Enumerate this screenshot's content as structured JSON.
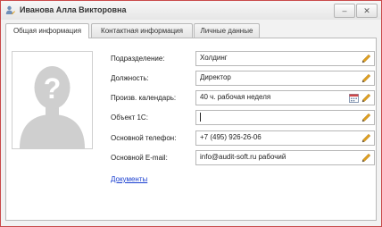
{
  "window": {
    "title": "Иванова Алла Викторовна",
    "minimize_symbol": "‒",
    "close_symbol": "✕",
    "icons": {
      "app": "user-edit-icon"
    }
  },
  "tabs": [
    {
      "label": "Общая информация",
      "active": true
    },
    {
      "label": "Контактная информация",
      "active": false
    },
    {
      "label": "Личные данные",
      "active": false
    }
  ],
  "photo": {
    "icon": "avatar-placeholder-icon"
  },
  "fields": {
    "department": {
      "label": "Подразделение:",
      "value": "Холдинг"
    },
    "position": {
      "label": "Должность:",
      "value": "Директор"
    },
    "calendar": {
      "label": "Произв. календарь:",
      "value": "40 ч. рабочая неделя"
    },
    "object1c": {
      "label": "Объект 1С:",
      "value": ""
    },
    "phone": {
      "label": "Основной телефон:",
      "value": "+7 (495) 926-26-06"
    },
    "email": {
      "label": "Основной E-mail:",
      "value": "info@audit-soft.ru рабочий"
    }
  },
  "documents_link": "Документы",
  "colors": {
    "window_border": "#c94a4a",
    "link": "#1a3fd0",
    "pencil": "#e0a020"
  }
}
